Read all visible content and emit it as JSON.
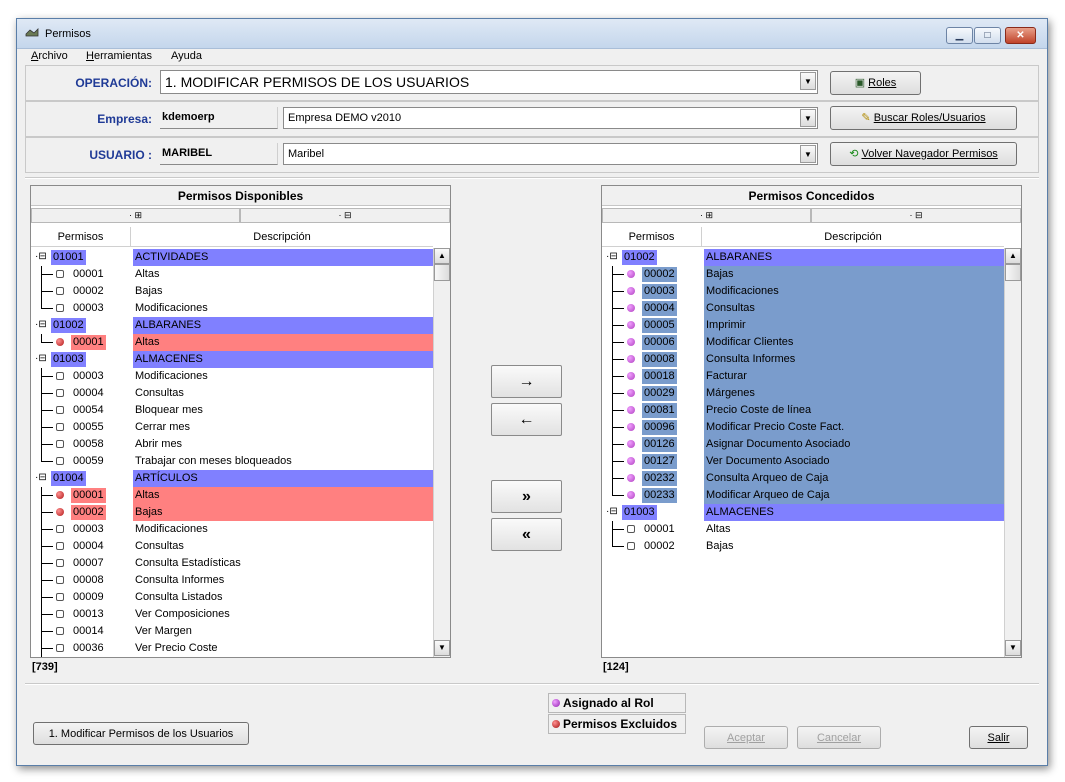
{
  "window": {
    "title": "Permisos",
    "buttons": {
      "minimize": "▁",
      "maximize": "□",
      "close": "✕"
    }
  },
  "menu": [
    "Archivo",
    "Herramientas",
    "Ayuda"
  ],
  "operacion": {
    "label": "OPERACIÓN:",
    "value": "1. MODIFICAR PERMISOS DE LOS USUARIOS",
    "button": "Roles"
  },
  "empresa": {
    "label": "Empresa:",
    "code": "kdemoerp",
    "value": "Empresa DEMO v2010",
    "button": "Buscar Roles/Usuarios"
  },
  "usuario": {
    "label": "USUARIO :",
    "code": "MARIBEL",
    "value": "Maribel",
    "button": "Volver Navegador Permisos"
  },
  "disponibles": {
    "title": "Permisos Disponibles",
    "col_permisos": "Permisos",
    "col_descripcion": "Descripción",
    "count": "[739]",
    "rows": [
      {
        "kind": "group",
        "code": "01001",
        "desc": "ACTIVIDADES"
      },
      {
        "kind": "leaf",
        "code": "00001",
        "desc": "Altas"
      },
      {
        "kind": "leaf",
        "code": "00002",
        "desc": "Bajas"
      },
      {
        "kind": "leaf",
        "code": "00003",
        "desc": "Modificaciones",
        "last": true
      },
      {
        "kind": "group",
        "code": "01002",
        "desc": "ALBARANES"
      },
      {
        "kind": "excluded",
        "code": "00001",
        "desc": "Altas",
        "last": true
      },
      {
        "kind": "group",
        "code": "01003",
        "desc": "ALMACENES"
      },
      {
        "kind": "leaf",
        "code": "00003",
        "desc": "Modificaciones"
      },
      {
        "kind": "leaf",
        "code": "00004",
        "desc": "Consultas"
      },
      {
        "kind": "leaf",
        "code": "00054",
        "desc": "Bloquear mes"
      },
      {
        "kind": "leaf",
        "code": "00055",
        "desc": "Cerrar mes"
      },
      {
        "kind": "leaf",
        "code": "00058",
        "desc": "Abrir mes"
      },
      {
        "kind": "leaf",
        "code": "00059",
        "desc": "Trabajar con meses bloqueados",
        "last": true
      },
      {
        "kind": "group",
        "code": "01004",
        "desc": "ARTÍCULOS"
      },
      {
        "kind": "excluded",
        "code": "00001",
        "desc": "Altas"
      },
      {
        "kind": "excluded",
        "code": "00002",
        "desc": "Bajas"
      },
      {
        "kind": "leaf",
        "code": "00003",
        "desc": "Modificaciones"
      },
      {
        "kind": "leaf",
        "code": "00004",
        "desc": "Consultas"
      },
      {
        "kind": "leaf",
        "code": "00007",
        "desc": "Consulta Estadísticas"
      },
      {
        "kind": "leaf",
        "code": "00008",
        "desc": "Consulta Informes"
      },
      {
        "kind": "leaf",
        "code": "00009",
        "desc": "Consulta Listados"
      },
      {
        "kind": "leaf",
        "code": "00013",
        "desc": "Ver Composiciones"
      },
      {
        "kind": "leaf",
        "code": "00014",
        "desc": "Ver Margen"
      },
      {
        "kind": "leaf",
        "code": "00036",
        "desc": "Ver Precio Coste"
      }
    ]
  },
  "concedidos": {
    "title": "Permisos Concedidos",
    "col_permisos": "Permisos",
    "col_descripcion": "Descripción",
    "count": "[124]",
    "rows": [
      {
        "kind": "group",
        "code": "01002",
        "desc": "ALBARANES"
      },
      {
        "kind": "role",
        "code": "00002",
        "desc": "Bajas"
      },
      {
        "kind": "role",
        "code": "00003",
        "desc": "Modificaciones"
      },
      {
        "kind": "role",
        "code": "00004",
        "desc": "Consultas"
      },
      {
        "kind": "role",
        "code": "00005",
        "desc": "Imprimir"
      },
      {
        "kind": "role",
        "code": "00006",
        "desc": "Modificar Clientes"
      },
      {
        "kind": "role",
        "code": "00008",
        "desc": "Consulta Informes"
      },
      {
        "kind": "role",
        "code": "00018",
        "desc": "Facturar"
      },
      {
        "kind": "role",
        "code": "00029",
        "desc": "Márgenes"
      },
      {
        "kind": "role",
        "code": "00081",
        "desc": "Precio Coste de línea"
      },
      {
        "kind": "role",
        "code": "00096",
        "desc": "Modificar Precio Coste Fact."
      },
      {
        "kind": "role",
        "code": "00126",
        "desc": "Asignar Documento Asociado"
      },
      {
        "kind": "role",
        "code": "00127",
        "desc": "Ver Documento Asociado"
      },
      {
        "kind": "role",
        "code": "00232",
        "desc": "Consulta Arqueo de Caja"
      },
      {
        "kind": "role",
        "code": "00233",
        "desc": "Modificar Arqueo de Caja",
        "last": true
      },
      {
        "kind": "group",
        "code": "01003",
        "desc": "ALMACENES"
      },
      {
        "kind": "leaf",
        "code": "00001",
        "desc": "Altas"
      },
      {
        "kind": "leaf",
        "code": "00002",
        "desc": "Bajas",
        "last": true
      }
    ]
  },
  "move_buttons": {
    "add": "→",
    "remove": "←",
    "add_all": "»",
    "remove_all": "«"
  },
  "legend": {
    "assigned": "Asignado al Rol",
    "excluded": "Permisos Excluidos"
  },
  "footer": {
    "operation_button": "1. Modificar Permisos de los Usuarios",
    "aceptar": "Aceptar",
    "cancelar": "Cancelar",
    "salir": "Salir"
  },
  "colors": {
    "group_bg": "#8080ff",
    "excluded_bg": "#ff8080",
    "role_bg": "#7a9ccc",
    "role_dot": "#b040c0",
    "excluded_dot": "#b01818",
    "label": "#1f3a96"
  }
}
